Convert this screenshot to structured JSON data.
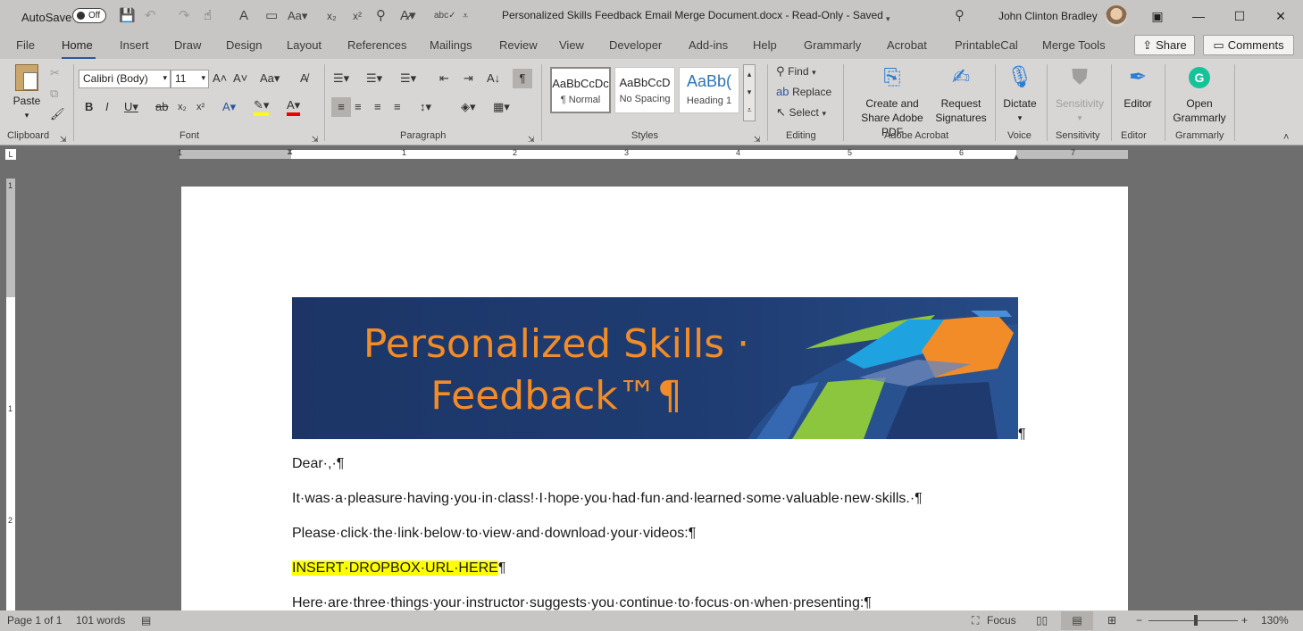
{
  "titlebar": {
    "autosave_label": "AutoSave",
    "autosave_state": "Off",
    "doc_title": "Personalized Skills Feedback Email Merge Document.docx  -  Read-Only  -  Saved",
    "user_name": "John Clinton Bradley"
  },
  "tabs": [
    "File",
    "Home",
    "Insert",
    "Draw",
    "Design",
    "Layout",
    "References",
    "Mailings",
    "Review",
    "View",
    "Developer",
    "Add-ins",
    "Help",
    "Grammarly",
    "Acrobat",
    "PrintableCal",
    "Merge Tools"
  ],
  "share_label": "Share",
  "comments_label": "Comments",
  "ribbon": {
    "paste_label": "Paste",
    "font_name": "Calibri (Body)",
    "font_size": "11",
    "styles": [
      {
        "sample": "AaBbCcDc",
        "label": "¶ Normal"
      },
      {
        "sample": "AaBbCcD",
        "label": "No Spacing"
      },
      {
        "sample": "AaBb(",
        "label": "Heading 1"
      }
    ],
    "find_label": "Find",
    "replace_label": "Replace",
    "select_label": "Select",
    "create_share_pdf": "Create and Share Adobe PDF",
    "request_signatures": "Request Signatures",
    "dictate_label": "Dictate",
    "sensitivity_label": "Sensitivity",
    "editor_label": "Editor",
    "open_grammarly": "Open Grammarly",
    "groups": [
      "Clipboard",
      "Font",
      "Paragraph",
      "Styles",
      "Editing",
      "Adobe Acrobat",
      "Voice",
      "Sensitivity",
      "Editor",
      "Grammarly"
    ]
  },
  "ruler_numbers": [
    "1",
    "1",
    "2",
    "3",
    "4",
    "5",
    "6",
    "7"
  ],
  "vruler_numbers": [
    "1",
    "1",
    "2"
  ],
  "document": {
    "banner_line1": "Personalized Skills ·",
    "banner_line2": "Feedback™¶",
    "banner_pilcrow": "¶",
    "p1": "Dear·,·¶",
    "p2": "It·was·a·pleasure·having·you·in·class!·I·hope·you·had·fun·and·learned·some·valuable·new·skills.·¶",
    "p3": "Please·click·the·link·below·to·view·and·download·your·videos:¶",
    "p4_highlight": "INSERT·DROPBOX·URL·HERE",
    "p4_tail": "¶",
    "p5": "Here·are·three·things·your·instructor·suggests·you·continue·to·focus·on·when·presenting:¶"
  },
  "statusbar": {
    "page": "Page 1 of 1",
    "words": "101 words",
    "focus": "Focus",
    "zoom": "130%"
  },
  "colors": {
    "banner_text": "#f28c28",
    "banner_bg": "#1f3d73",
    "highlight": "#ffff00",
    "accent": "#2b579a"
  }
}
